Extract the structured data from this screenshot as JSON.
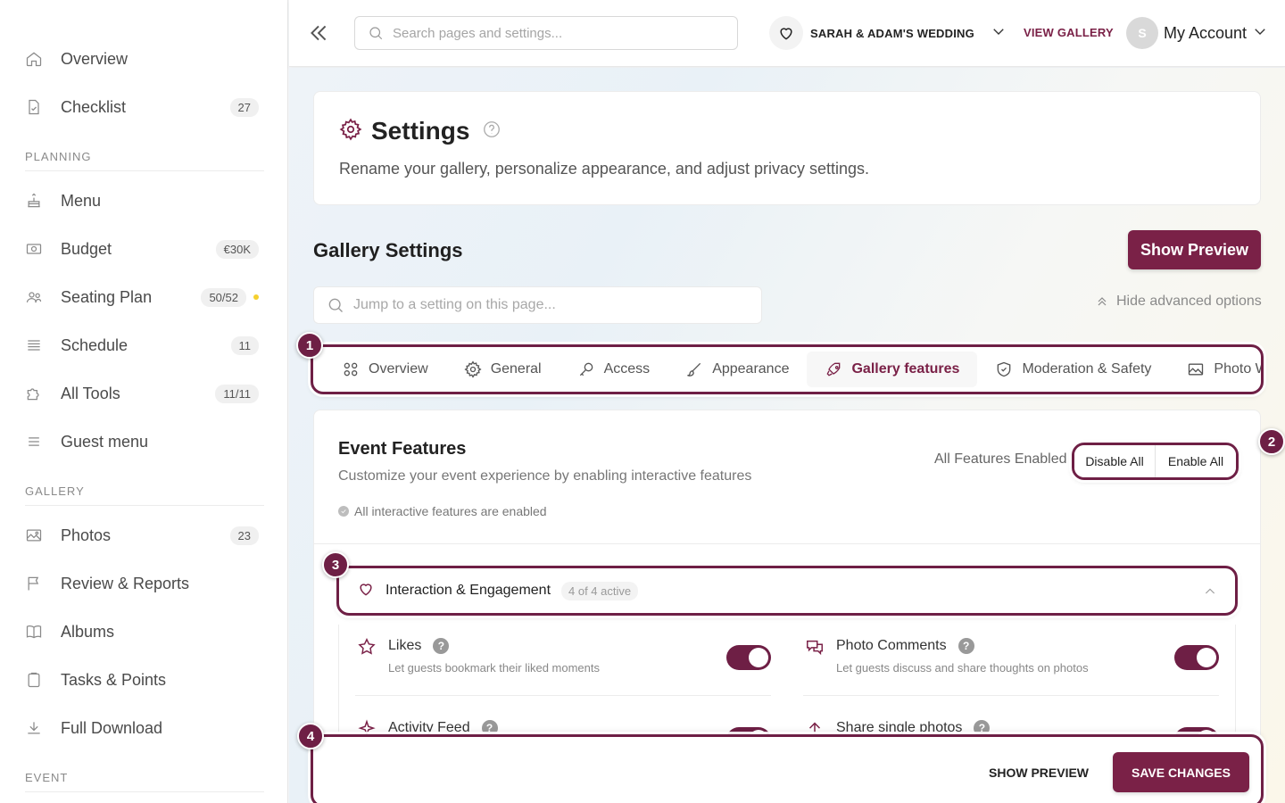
{
  "sidebar": {
    "items": [
      {
        "label": "Overview",
        "icon": "home-icon"
      },
      {
        "label": "Checklist",
        "icon": "checklist-icon",
        "badge": "27"
      },
      {
        "label": "Menu",
        "icon": "cake-icon"
      },
      {
        "label": "Budget",
        "icon": "money-icon",
        "badge": "€30K"
      },
      {
        "label": "Seating Plan",
        "icon": "people-icon",
        "badge": "50/52"
      },
      {
        "label": "Schedule",
        "icon": "list-icon",
        "badge": "11"
      },
      {
        "label": "All Tools",
        "icon": "puzzle-icon",
        "badge": "11/11"
      },
      {
        "label": "Guest menu",
        "icon": "menu-icon"
      },
      {
        "label": "Photos",
        "icon": "image-icon",
        "badge": "23"
      },
      {
        "label": "Review & Reports",
        "icon": "flag-icon"
      },
      {
        "label": "Albums",
        "icon": "book-icon"
      },
      {
        "label": "Tasks & Points",
        "icon": "clipboard-icon"
      },
      {
        "label": "Full Download",
        "icon": "download-icon"
      }
    ],
    "sections": {
      "planning": "PLANNING",
      "gallery": "GALLERY",
      "event": "EVENT"
    }
  },
  "topbar": {
    "search_placeholder": "Search pages and settings...",
    "event_name": "SARAH & ADAM'S WEDDING",
    "view_gallery": "VIEW GALLERY",
    "avatar_initial": "S",
    "account_label": "My Account"
  },
  "settings": {
    "title": "Settings",
    "subtitle": "Rename your gallery, personalize appearance, and adjust privacy settings."
  },
  "gallery": {
    "title": "Gallery Settings",
    "show_preview": "Show Preview",
    "jump_placeholder": "Jump to a setting on this page...",
    "hide_advanced": "Hide advanced options",
    "tabs": [
      {
        "label": "Overview",
        "icon": "grid-icon"
      },
      {
        "label": "General",
        "icon": "gear-icon"
      },
      {
        "label": "Access",
        "icon": "key-icon"
      },
      {
        "label": "Appearance",
        "icon": "brush-icon"
      },
      {
        "label": "Gallery features",
        "icon": "rocket-icon",
        "active": true
      },
      {
        "label": "Moderation & Safety",
        "icon": "shield-icon"
      },
      {
        "label": "Photo Wall",
        "icon": "image-icon"
      }
    ]
  },
  "features": {
    "title": "Event Features",
    "subtitle": "Customize your event experience by enabling interactive features",
    "status": "All interactive features are enabled",
    "all_enabled": "All Features Enabled",
    "disable_all": "Disable All",
    "enable_all": "Enable All",
    "group": {
      "title": "Interaction & Engagement",
      "count": "4 of 4 active"
    },
    "items": [
      {
        "title": "Likes",
        "desc": "Let guests bookmark their liked moments",
        "icon": "star-icon",
        "enabled": true
      },
      {
        "title": "Photo Comments",
        "desc": "Let guests discuss and share thoughts on photos",
        "icon": "chat-icon",
        "enabled": true
      },
      {
        "title": "Activity Feed",
        "desc": "",
        "icon": "sparkle-icon",
        "enabled": true
      },
      {
        "title": "Share single photos",
        "desc": "",
        "icon": "share-icon",
        "enabled": true
      }
    ]
  },
  "bottom_bar": {
    "show_preview": "SHOW PREVIEW",
    "save_changes": "SAVE CHANGES"
  },
  "markers": [
    "1",
    "2",
    "3",
    "4"
  ],
  "colors": {
    "accent": "#7a2147",
    "highlight_border": "#6e1f45",
    "seating_dot": "#f5d02e"
  }
}
